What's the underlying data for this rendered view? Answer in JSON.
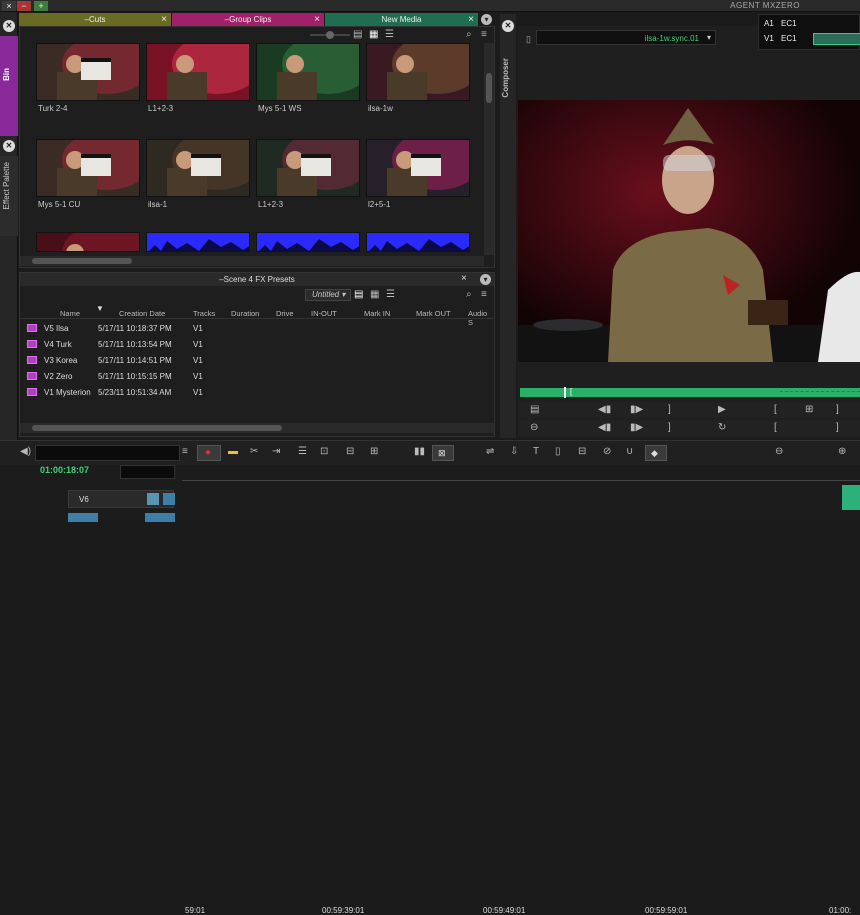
{
  "window": {
    "title": "AGENT MXZERO",
    "minimize": "−",
    "maximize": "+"
  },
  "left_strip": {
    "bin_tab": "Bin",
    "effect_palette_tab": "Effect Palette",
    "close1": "⊗",
    "close2": "⊗"
  },
  "bin_tabs": [
    {
      "label": "–Cuts",
      "color": "#6a6b22"
    },
    {
      "label": "–Group Clips",
      "color": "#a0206a"
    },
    {
      "label": "New Media",
      "color": "#1f6e4f"
    }
  ],
  "thumbs": [
    {
      "label": "Turk 2-4",
      "kind": "clapper"
    },
    {
      "label": "L1+2-3",
      "kind": "red"
    },
    {
      "label": "Mys 5-1 WS",
      "kind": "green"
    },
    {
      "label": "ilsa-1w",
      "kind": "woman"
    },
    {
      "label": "Mys 5-1 CU",
      "kind": "clapper"
    },
    {
      "label": "ilsa-1",
      "kind": "clapper2"
    },
    {
      "label": "L1+2-3",
      "kind": "clapper3"
    },
    {
      "label": "l2+5-1",
      "kind": "clapper4"
    },
    {
      "label": "",
      "kind": "red2"
    },
    {
      "label": "",
      "kind": "blue"
    },
    {
      "label": "",
      "kind": "blue"
    },
    {
      "label": "",
      "kind": "blue"
    }
  ],
  "presets": {
    "title": "–Scene 4 FX Presets",
    "view_dropdown": "Untitled",
    "columns": [
      "Name",
      "Creation Date",
      "Tracks",
      "Duration",
      "Drive",
      "IN-OUT",
      "Mark IN",
      "Mark OUT",
      "Audio S"
    ],
    "rows": [
      {
        "name": "V5 Ilsa",
        "date": "5/17/11 10:18:37 PM",
        "tracks": "V1"
      },
      {
        "name": "V4 Turk",
        "date": "5/17/11 10:13:54 PM",
        "tracks": "V1"
      },
      {
        "name": "V3 Korea",
        "date": "5/17/11 10:14:51 PM",
        "tracks": "V1"
      },
      {
        "name": "V2 Zero",
        "date": "5/17/11 10:15:15 PM",
        "tracks": "V1"
      },
      {
        "name": "V1 Mysterion",
        "date": "5/23/11 10:51:34 AM",
        "tracks": "V1"
      }
    ]
  },
  "composer": {
    "tab": "Composer",
    "clip_name": "ilsa-1w.sync.01",
    "track_a1": "A1",
    "track_a1_val": "EC1",
    "track_v1": "V1",
    "track_v1_val": "EC1"
  },
  "timeline": {
    "timecode": "01:00:18:07",
    "ticks": [
      "59:01",
      "00:59:39:01",
      "00:59:49:01",
      "00:59:59:01",
      "01:00:"
    ],
    "track_v6": "V6"
  },
  "colors": {
    "accent_green": "#2fb36a",
    "preset_purple": "#b040c0"
  }
}
